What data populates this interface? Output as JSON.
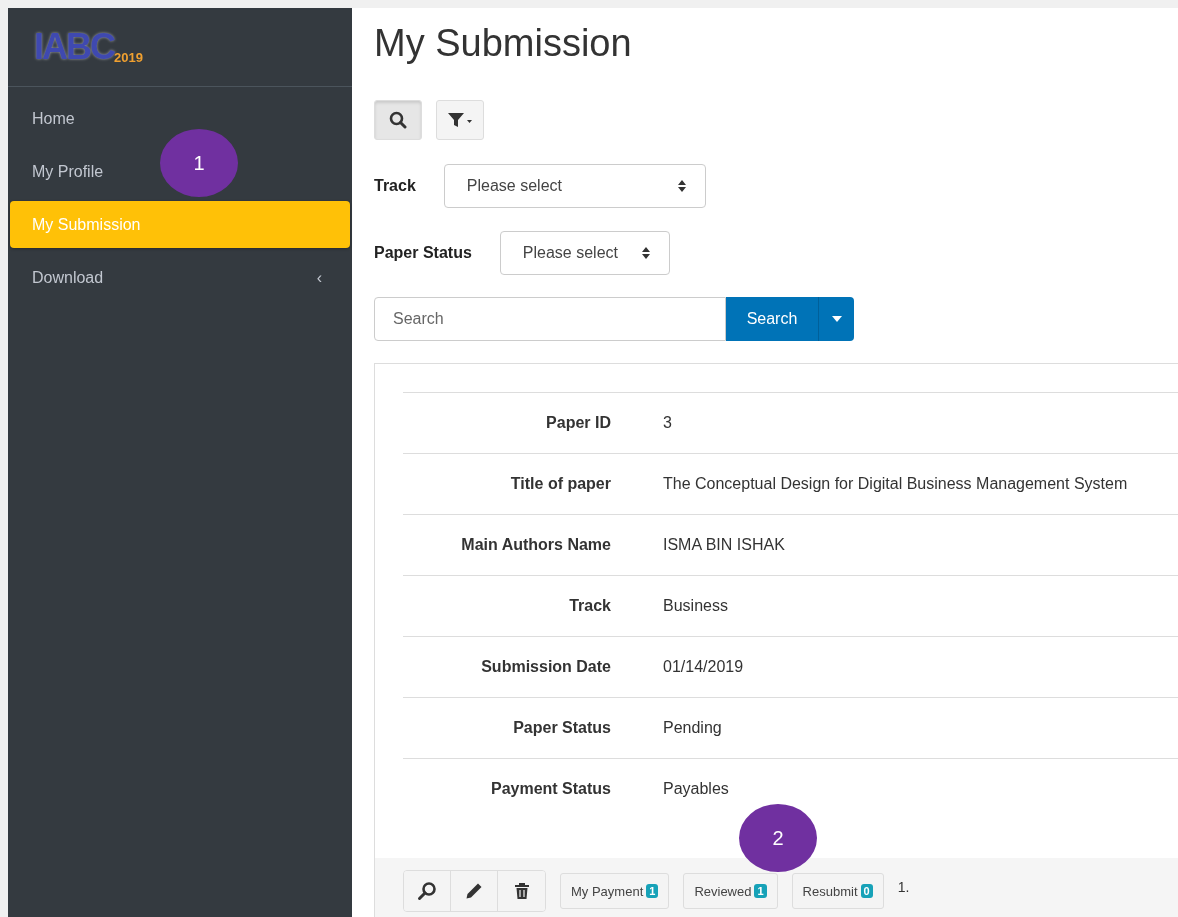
{
  "logo": {
    "text": "IABC",
    "year": "2019"
  },
  "sidebar": {
    "items": [
      {
        "label": "Home",
        "selected": false
      },
      {
        "label": "My Profile",
        "selected": false
      },
      {
        "label": "My Submission",
        "selected": true
      },
      {
        "label": "Download",
        "selected": false,
        "caret": "‹"
      }
    ]
  },
  "page_title": "My Submission",
  "filters": [
    {
      "label": "Track",
      "placeholder": "Please select",
      "kind": "wide"
    },
    {
      "label": "Paper Status",
      "placeholder": "Please select",
      "kind": "narrow"
    }
  ],
  "search": {
    "placeholder": "Search",
    "button": "Search"
  },
  "details": [
    {
      "label": "Paper ID",
      "value": "3"
    },
    {
      "label": "Title of paper",
      "value": "The Conceptual Design for Digital Business Management System"
    },
    {
      "label": "Main Authors Name",
      "value": "ISMA BIN ISHAK"
    },
    {
      "label": "Track",
      "value": "Business"
    },
    {
      "label": "Submission Date",
      "value": "01/14/2019"
    },
    {
      "label": "Paper Status",
      "value": "Pending"
    },
    {
      "label": "Payment Status",
      "value": "Payables"
    }
  ],
  "actions": [
    {
      "label": "My Payment",
      "count": "1"
    },
    {
      "label": "Reviewed",
      "count": "1"
    },
    {
      "label": "Resubmit",
      "count": "0"
    }
  ],
  "row_number": "1.",
  "annotations": [
    {
      "number": "1"
    },
    {
      "number": "2"
    }
  ]
}
